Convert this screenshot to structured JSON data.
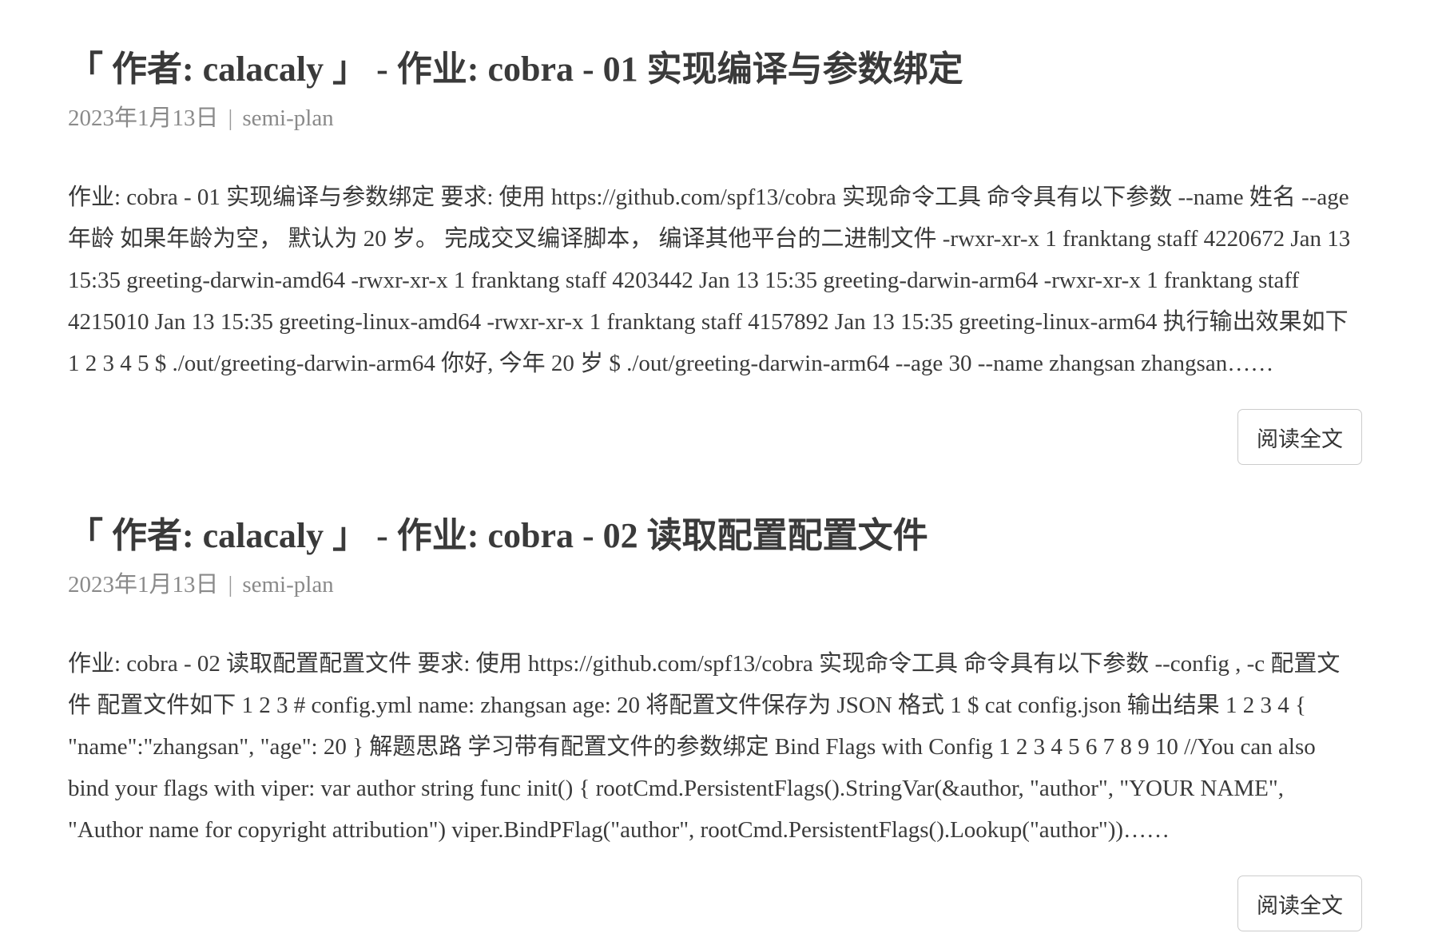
{
  "posts": [
    {
      "title": "「 作者: calacaly 」 - 作业: cobra - 01 实现编译与参数绑定",
      "date": "2023年1月13日",
      "separator": "|",
      "category": "semi-plan",
      "excerpt": "作业: cobra - 01 实现编译与参数绑定 要求: 使用 https://github.com/spf13/cobra 实现命令工具 命令具有以下参数 --name 姓名 --age 年龄 如果年龄为空， 默认为 20 岁。 完成交叉编译脚本， 编译其他平台的二进制文件 -rwxr-xr-x 1 franktang staff 4220672 Jan 13 15:35 greeting-darwin-amd64 -rwxr-xr-x 1 franktang staff 4203442 Jan 13 15:35 greeting-darwin-arm64 -rwxr-xr-x 1 franktang staff 4215010 Jan 13 15:35 greeting-linux-amd64 -rwxr-xr-x 1 franktang staff 4157892 Jan 13 15:35 greeting-linux-arm64 执行输出效果如下 1 2 3 4 5 $ ./out/greeting-darwin-arm64 你好, 今年 20 岁 $ ./out/greeting-darwin-arm64 --age 30 --name zhangsan zhangsan……",
      "read_more_label": "阅读全文"
    },
    {
      "title": "「 作者: calacaly 」 - 作业: cobra - 02 读取配置配置文件",
      "date": "2023年1月13日",
      "separator": "|",
      "category": "semi-plan",
      "excerpt": "作业: cobra - 02 读取配置配置文件 要求: 使用 https://github.com/spf13/cobra 实现命令工具 命令具有以下参数 --config , -c 配置文件 配置文件如下 1 2 3 # config.yml name: zhangsan age: 20 将配置文件保存为 JSON 格式 1 $ cat config.json 输出结果 1 2 3 4 { \"name\":\"zhangsan\", \"age\": 20 } 解题思路 学习带有配置文件的参数绑定 Bind Flags with Config 1 2 3 4 5 6 7 8 9 10 //You can also bind your flags with viper: var author string func init() { rootCmd.PersistentFlags().StringVar(&author, \"author\", \"YOUR NAME\", \"Author name for copyright attribution\") viper.BindPFlag(\"author\", rootCmd.PersistentFlags().Lookup(\"author\"))……",
      "read_more_label": "阅读全文"
    }
  ],
  "colors": {
    "title": "#3a3a3a",
    "meta": "#8a8a8a",
    "text": "#3a3a3a",
    "button_border": "#cccccc",
    "background": "#ffffff"
  }
}
